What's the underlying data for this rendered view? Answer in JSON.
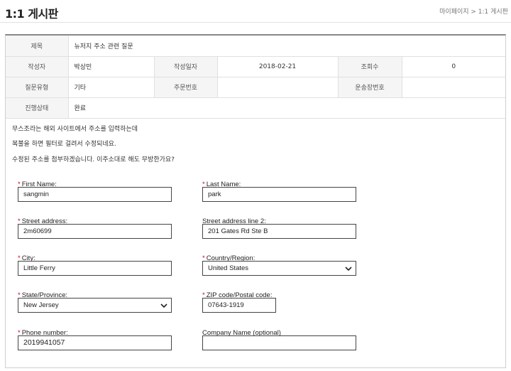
{
  "header": {
    "title": "1:1 게시판",
    "breadcrumb": "마이페이지 > 1:1 게시판"
  },
  "info": {
    "subject_label": "제목",
    "subject": "뉴저지 주소 관련 질문",
    "author_label": "작성자",
    "author": "박상민",
    "date_label": "작성일자",
    "date": "2018-02-21",
    "views_label": "조회수",
    "views": "0",
    "type_label": "질문유형",
    "type": "기타",
    "order_label": "주문번호",
    "order": "",
    "tracking_label": "운송장번호",
    "tracking": "",
    "status_label": "진행상태",
    "status": "완료"
  },
  "body": {
    "line1": "무스조라는 해외 사이트에서 주소를 입력하는데",
    "line2": "복불을 하면 필터로 걸려서 수정되네요.",
    "line3": "수정된 주소를 첨부하겠습니다. 이주소대로 해도 무방한가요?"
  },
  "form": {
    "required_mark": "*",
    "first_name_label": "First Name:",
    "first_name": "sangmin",
    "last_name_label": "Last Name:",
    "last_name": "park",
    "street_label": "Street address:",
    "street": "2m60699",
    "street2_label": "Street address line 2:",
    "street2": "201 Gates Rd Ste B",
    "city_label": "City:",
    "city": "Little Ferry",
    "country_label": "Country/Region:",
    "country": "United States",
    "state_label": "State/Province:",
    "state": "New Jersey",
    "zip_label": "ZIP code/Postal code:",
    "zip": "07643-1919",
    "phone_label": "Phone number:",
    "phone": "2019941057",
    "company_label": "Company Name (optional)",
    "company": ""
  }
}
